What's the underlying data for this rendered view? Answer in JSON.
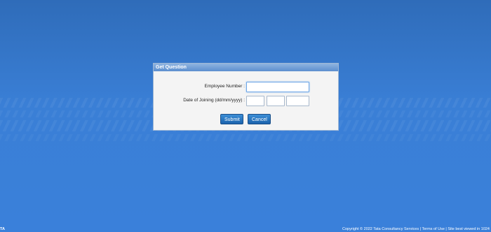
{
  "dialog": {
    "title": "Get Question",
    "employee_number_label": "Employee Number :",
    "employee_number_value": "",
    "date_of_joining_label": "Date of Joining (dd/mm/yyyy) :",
    "dd_value": "",
    "mm_value": "",
    "yyyy_value": "",
    "submit_label": "Submit",
    "cancel_label": "Cancel"
  },
  "footer": {
    "corner_text": "TA",
    "text": "Copyright © 2022 Tata Consultancy Services | Terms of Use | Site best viewed in 1024"
  },
  "colors": {
    "background": "#3a7fd6",
    "title_bar": "#6f9ed8",
    "button": "#1f6bb8"
  }
}
